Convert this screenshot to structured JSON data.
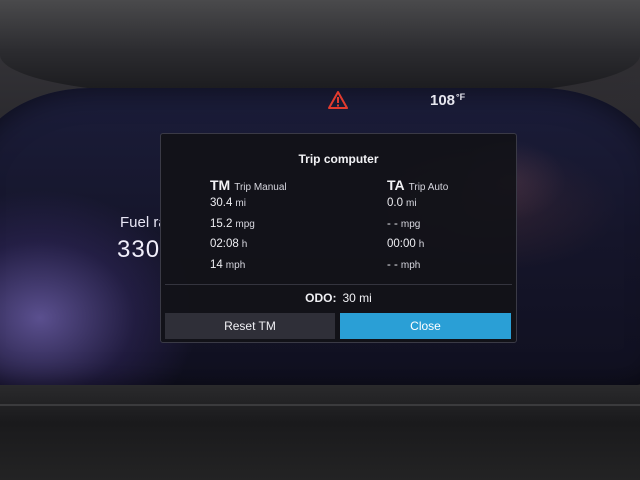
{
  "status_bar": {
    "warning_icon": "warning-triangle-icon",
    "warning_color": "#e33b2e",
    "outside_temp": "108",
    "outside_temp_unit": "°F"
  },
  "background_gauge": {
    "label": "Fuel ra",
    "value": "330"
  },
  "trip_computer": {
    "title": "Trip computer",
    "manual": {
      "abbr": "TM",
      "name": "Trip Manual",
      "distance": "30.4",
      "distance_unit": "mi",
      "fuel_economy": "15.2",
      "fuel_economy_unit": "mpg",
      "time": "02:08",
      "time_unit": "h",
      "avg_speed": "14",
      "avg_speed_unit": "mph"
    },
    "auto": {
      "abbr": "TA",
      "name": "Trip Auto",
      "distance": "0.0",
      "distance_unit": "mi",
      "fuel_economy": "- -",
      "fuel_economy_unit": "mpg",
      "time": "00:00",
      "time_unit": "h",
      "avg_speed": "- -",
      "avg_speed_unit": "mph"
    },
    "odometer": {
      "label": "ODO:",
      "value": "30 mi"
    },
    "buttons": {
      "reset_label": "Reset TM",
      "close_label": "Close"
    },
    "accent_color": "#2a9fd6"
  }
}
